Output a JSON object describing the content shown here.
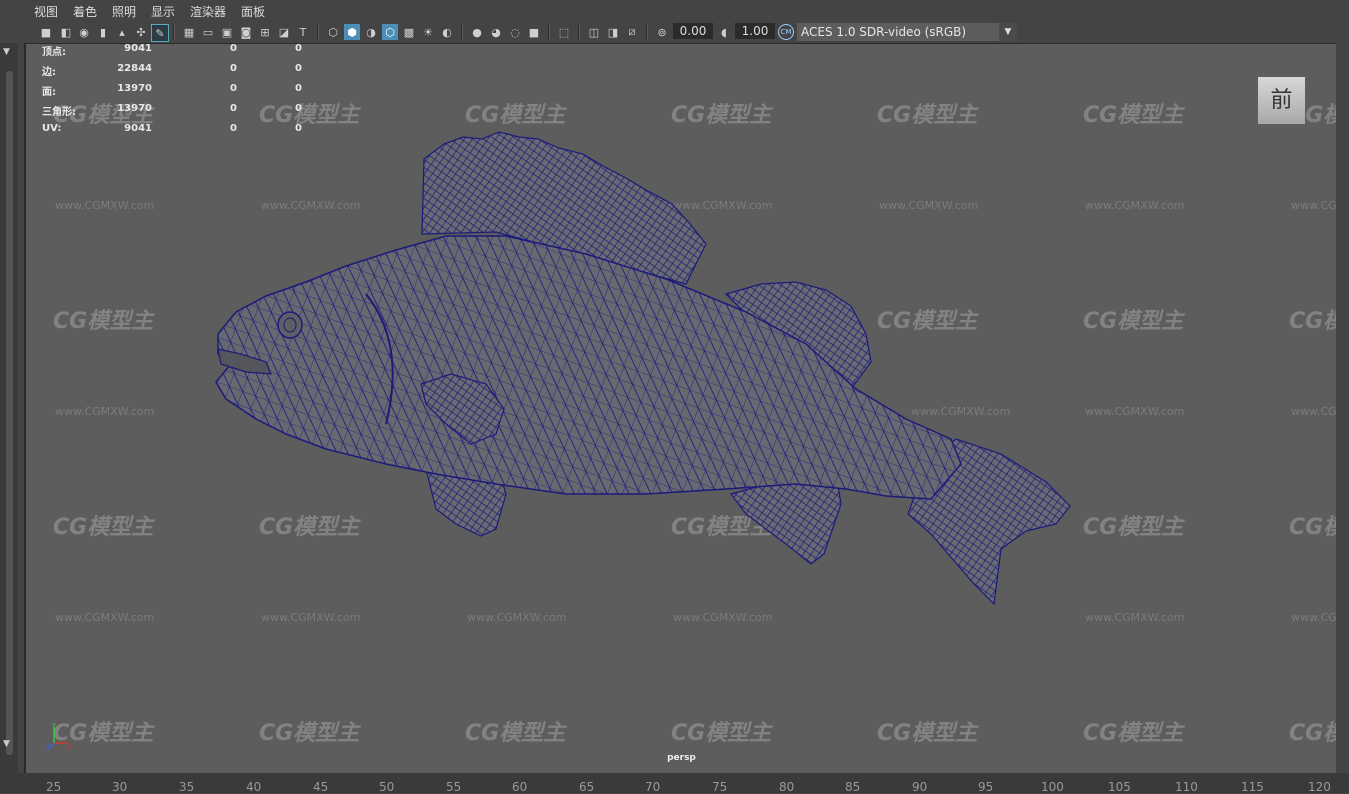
{
  "menu": [
    "视图",
    "着色",
    "照明",
    "显示",
    "渲染器",
    "面板"
  ],
  "toolbar": {
    "exposure": "0.00",
    "gamma": "1.00",
    "color_management": "ACES 1.0 SDR-video (sRGB)"
  },
  "hud": [
    {
      "label": "顶点:",
      "v1": "9041",
      "v2": "0",
      "v3": "0"
    },
    {
      "label": "边:",
      "v1": "22844",
      "v2": "0",
      "v3": "0"
    },
    {
      "label": "面:",
      "v1": "13970",
      "v2": "0",
      "v3": "0"
    },
    {
      "label": "三角形:",
      "v1": "13970",
      "v2": "0",
      "v3": "0"
    },
    {
      "label": "UV:",
      "v1": "9041",
      "v2": "0",
      "v3": "0"
    }
  ],
  "viewcube_label": "前",
  "camera_name": "persp",
  "watermark": {
    "logo": "CG模型主",
    "url": "www.CGMXW.com"
  },
  "axis": {
    "x": "x",
    "y": "y",
    "z": "z"
  },
  "ruler_ticks": [
    "25",
    "30",
    "35",
    "40",
    "45",
    "50",
    "55",
    "60",
    "65",
    "70",
    "75",
    "80",
    "85",
    "90",
    "95",
    "100",
    "105",
    "110",
    "115",
    "120"
  ],
  "colors": {
    "wire": "#1b1b7a",
    "bg": "#5d5d5d"
  }
}
